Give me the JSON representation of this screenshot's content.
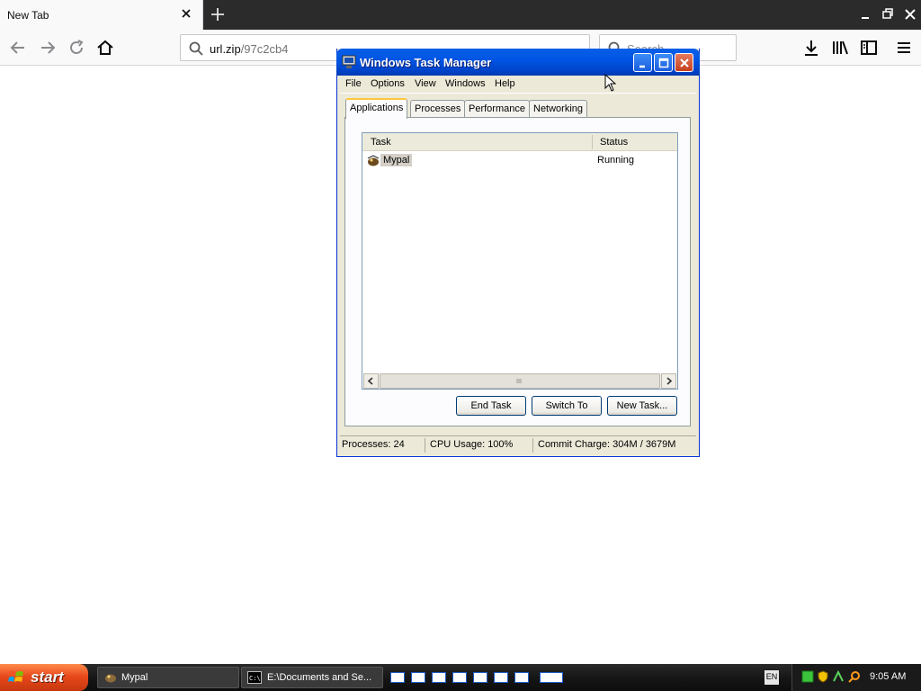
{
  "browser": {
    "tab_title": "New Tab",
    "url_host": "url.zip",
    "url_path": "/97c2cb4",
    "search_placeholder": "Search"
  },
  "task_manager": {
    "title": "Windows Task Manager",
    "menu": [
      "File",
      "Options",
      "View",
      "Windows",
      "Help"
    ],
    "tabs": [
      "Applications",
      "Processes",
      "Performance",
      "Networking"
    ],
    "active_tab": "Applications",
    "columns": {
      "task": "Task",
      "status": "Status"
    },
    "rows": [
      {
        "task": "Mypal",
        "status": "Running"
      }
    ],
    "buttons": {
      "end_task": "End Task",
      "switch_to": "Switch To",
      "new_task": "New Task..."
    },
    "status": {
      "processes": "Processes: 24",
      "cpu": "CPU Usage: 100%",
      "commit": "Commit Charge: 304M / 3679M"
    }
  },
  "taskbar": {
    "start_label": "start",
    "items": [
      {
        "label": "Mypal",
        "icon": "mypal-icon"
      },
      {
        "label": "E:\\Documents and Se...",
        "icon": "cmd-icon"
      }
    ],
    "language": "EN",
    "clock": "9:05 AM"
  },
  "colors": {
    "xp_title_blue": "#0055e5",
    "start_orange": "#e8491c",
    "taskbar_dark": "#161616"
  }
}
